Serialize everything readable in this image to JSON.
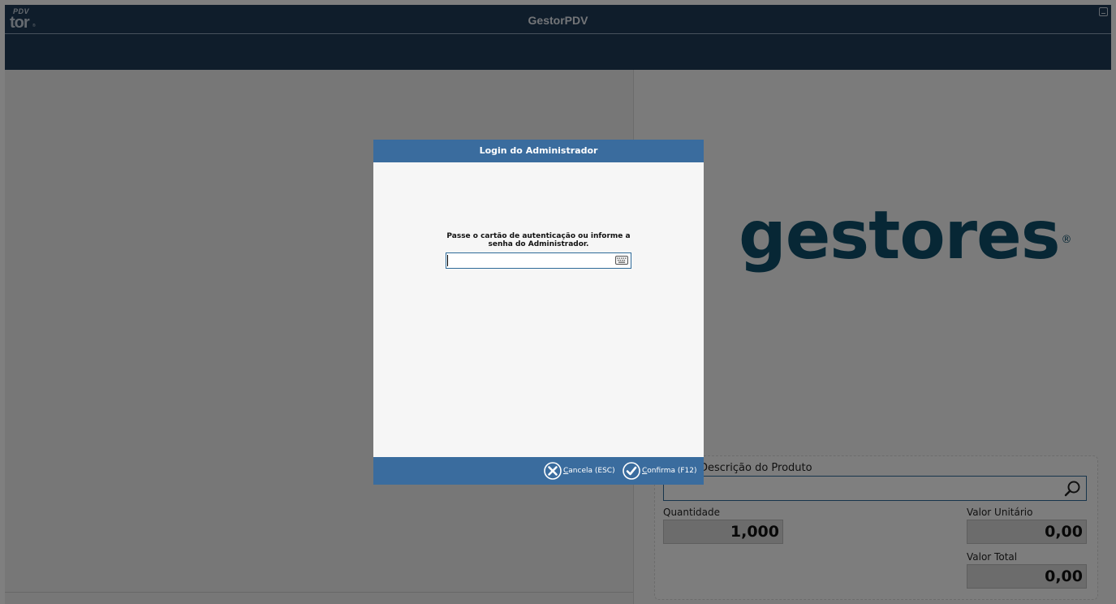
{
  "window": {
    "title": "GestorPDV",
    "logo_sup": "PDV",
    "logo_main": "tor",
    "logo_reg": "®"
  },
  "brand": {
    "name": "gestores",
    "reg": "®",
    "color": "#0e4f6b"
  },
  "product": {
    "description_label": "Descrição do Produto",
    "description_value": "",
    "quantity_label": "Quantidade",
    "quantity_value": "1,000",
    "unit_price_label": "Valor Unitário",
    "unit_price_value": "0,00",
    "total_label": "Valor Total",
    "total_value": "0,00"
  },
  "dialog": {
    "title": "Login do Administrador",
    "message": "Passe o cartão de autenticação ou informe a senha do Administrador.",
    "password_value": "",
    "cancel_accel": "C",
    "cancel_rest": "ancela (ESC)",
    "confirm_accel": "C",
    "confirm_rest": "onfirma (F12)"
  },
  "colors": {
    "titlebar": "#1f3a56",
    "dialog_accent": "#3a6c9e"
  }
}
